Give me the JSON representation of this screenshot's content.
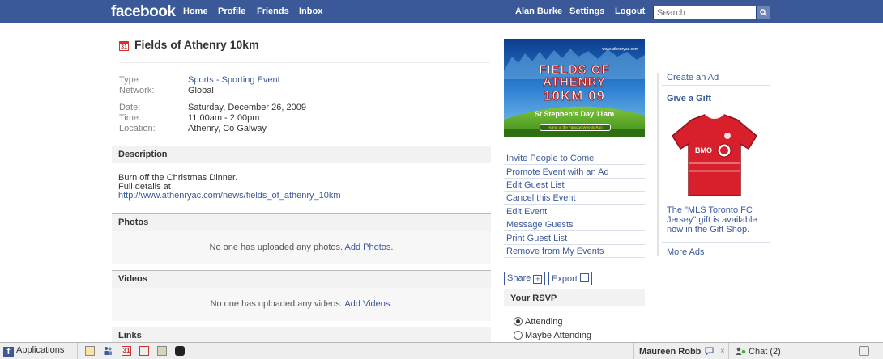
{
  "topbar": {
    "logo": "facebook",
    "nav": [
      "Home",
      "Profile",
      "Friends",
      "Inbox"
    ],
    "user": "Alan Burke",
    "settings": "Settings",
    "logout": "Logout",
    "search_placeholder": "Search"
  },
  "event": {
    "title": "Fields of Athenry 10km",
    "calendar_day": "31",
    "info": [
      {
        "label": "Type:",
        "value": "Sports - Sporting Event",
        "link": true
      },
      {
        "label": "Network:",
        "value": "Global",
        "link": false
      },
      {
        "label": "Date:",
        "value": "Saturday, December 26, 2009",
        "link": false
      },
      {
        "label": "Time:",
        "value": "11:00am - 2:00pm",
        "link": false
      },
      {
        "label": "Location:",
        "value": "Athenry, Co Galway",
        "link": false
      }
    ]
  },
  "description": {
    "heading": "Description",
    "line1": "Burn off the Christmas Dinner.",
    "line2": "Full details at",
    "url": "http://www.athenryac.com/news/fields_of_athenry_10km"
  },
  "photos": {
    "heading": "Photos",
    "empty": "No one has uploaded any photos.",
    "add": "Add Photos."
  },
  "videos": {
    "heading": "Videos",
    "empty": "No one has uploaded any videos.",
    "add": "Add Videos."
  },
  "links": {
    "heading": "Links"
  },
  "poster": {
    "site": "www.athenryac.com",
    "line1": "FIELDS OF",
    "line2": "ATHENRY",
    "line3": "10KM 09",
    "line4": "St Stephen's Day 11am",
    "footer": "Home of the Famous Weekly Run"
  },
  "actions": [
    "Invite People to Come",
    "Promote Event with an Ad",
    "Edit Guest List",
    "Cancel this Event",
    "Edit Event",
    "Message Guests",
    "Print Guest List",
    "Remove from My Events"
  ],
  "share": {
    "share_label": "Share",
    "share_icon": "+",
    "export_label": "Export"
  },
  "rsvp": {
    "heading": "Your RSVP",
    "options": [
      {
        "label": "Attending",
        "selected": true
      },
      {
        "label": "Maybe Attending",
        "selected": false
      }
    ]
  },
  "ads": {
    "create": "Create an Ad",
    "gift_title": "Give a Gift",
    "jersey_logo": "BMO",
    "gift_text": "The \"MLS Toronto FC Jersey\" gift is available now in the Gift Shop.",
    "more": "More Ads"
  },
  "bottombar": {
    "applications": "Applications",
    "app_icons": [
      "photos-icon",
      "groups-icon",
      "events-icon",
      "notes-icon",
      "links-icon",
      "mobile-icon"
    ],
    "chat_user": "Maureen Robb",
    "chat_close": "×",
    "chat_label": "Chat (2)"
  },
  "colors": {
    "brand": "#3b5998",
    "jersey": "#d7202c"
  }
}
